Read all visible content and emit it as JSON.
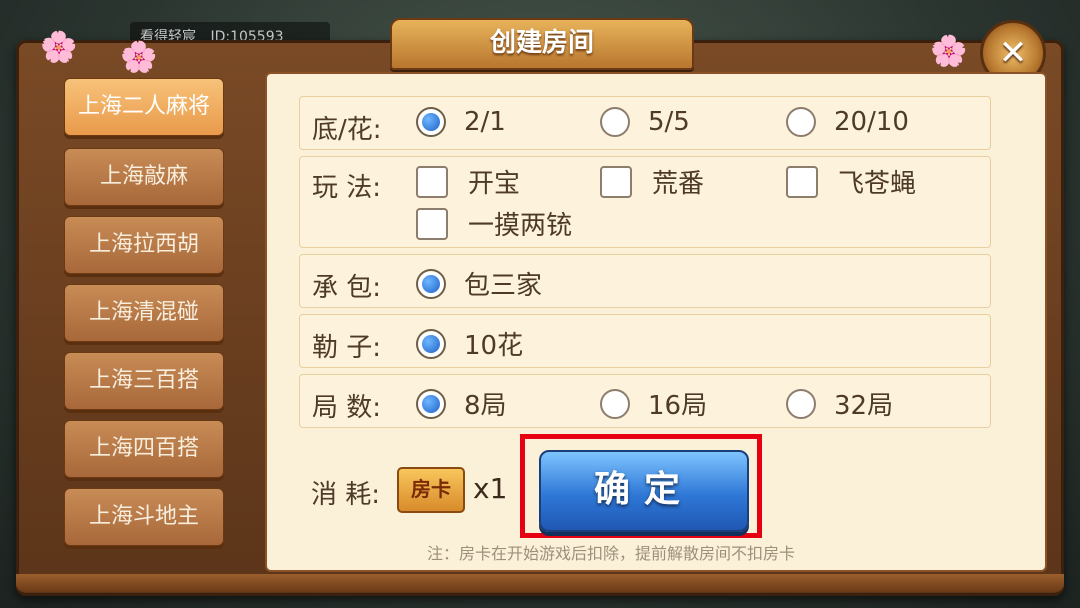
{
  "user": {
    "name": "看得轻宸",
    "id_text": "ID:105593"
  },
  "dialog": {
    "title": "创建房间",
    "close_label": "✕"
  },
  "sidebar": {
    "items": [
      {
        "label": "上海二人麻将",
        "active": true
      },
      {
        "label": "上海敲麻",
        "active": false
      },
      {
        "label": "上海拉西胡",
        "active": false
      },
      {
        "label": "上海清混碰",
        "active": false
      },
      {
        "label": "上海三百搭",
        "active": false
      },
      {
        "label": "上海四百搭",
        "active": false
      },
      {
        "label": "上海斗地主",
        "active": false
      }
    ]
  },
  "options": {
    "base": {
      "label": "底/花:",
      "choices": [
        "2/1",
        "5/5",
        "20/10"
      ],
      "selected": "2/1"
    },
    "play": {
      "label": "玩 法:",
      "choices": [
        "开宝",
        "荒番",
        "飞苍蝇",
        "一摸两铳"
      ],
      "checked": []
    },
    "contract": {
      "label": "承 包:",
      "choices": [
        "包三家"
      ],
      "selected": "包三家"
    },
    "lezi": {
      "label": "勒 子:",
      "choices": [
        "10花"
      ],
      "selected": "10花"
    },
    "rounds": {
      "label": "局 数:",
      "choices": [
        "8局",
        "16局",
        "32局"
      ],
      "selected": "8局"
    }
  },
  "consume": {
    "label": "消 耗:",
    "card_label": "房卡",
    "count": "x1"
  },
  "confirm": {
    "label": "确定"
  },
  "note": "注：房卡在开始游戏后扣除，提前解散房间不扣房卡",
  "colors": {
    "highlight": "#e60012",
    "confirm": "#2f78d6",
    "selected_radio": "#1e63c8"
  }
}
